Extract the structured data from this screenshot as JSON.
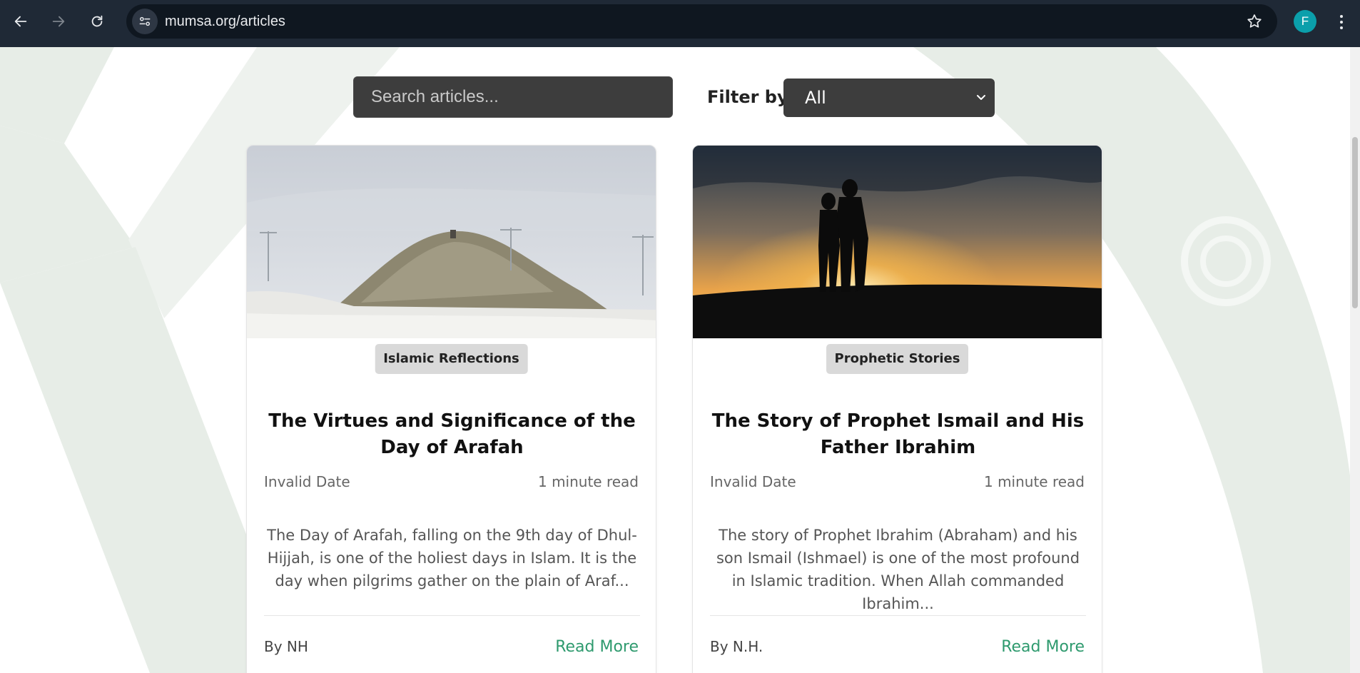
{
  "browser": {
    "url": "mumsa.org/articles",
    "profile_initial": "F"
  },
  "toolbar": {
    "search_placeholder": "Search articles...",
    "filter_label": "Filter by:",
    "filter_value": "All"
  },
  "articles": [
    {
      "category": "Islamic Reflections",
      "title": "The Virtues and Significance of the Day of Arafah",
      "date": "Invalid Date",
      "read_time": "1 minute read",
      "excerpt": "The Day of Arafah, falling on the 9th day of Dhul-Hijjah, is one of the holiest days in Islam. It is the day when pilgrims gather on the plain of Araf...",
      "author": "By NH",
      "read_more": "Read More"
    },
    {
      "category": "Prophetic Stories",
      "title": "The Story of Prophet Ismail and His Father Ibrahim",
      "date": "Invalid Date",
      "read_time": "1 minute read",
      "excerpt": "The story of Prophet Ibrahim (Abraham) and his son Ismail (Ishmael) is one of the most profound in Islamic tradition. When Allah commanded Ibrahim...",
      "author": "By N.H.",
      "read_more": "Read More"
    }
  ],
  "colors": {
    "link": "#2e9a6e",
    "chrome": "#1f2936",
    "input_bg": "#3d3d3d",
    "decor": "#e7ede7"
  }
}
